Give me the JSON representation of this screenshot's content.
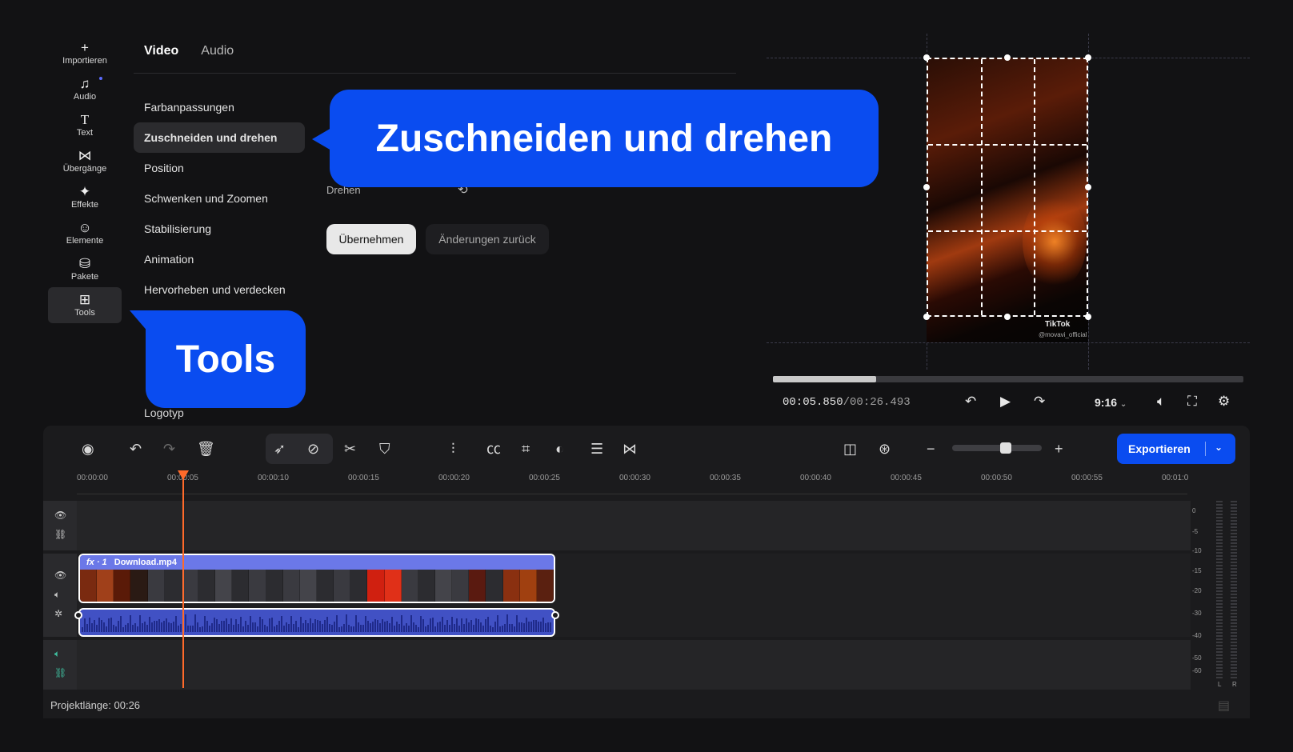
{
  "sidebar": {
    "items": [
      {
        "label": "Importieren",
        "icon": "plus-icon"
      },
      {
        "label": "Audio",
        "icon": "music-note-icon"
      },
      {
        "label": "Text",
        "icon": "text-icon"
      },
      {
        "label": "Übergänge",
        "icon": "transitions-icon"
      },
      {
        "label": "Effekte",
        "icon": "effects-icon"
      },
      {
        "label": "Elemente",
        "icon": "smiley-icon"
      },
      {
        "label": "Pakete",
        "icon": "package-icon"
      },
      {
        "label": "Tools",
        "icon": "tools-grid-icon",
        "active": true
      }
    ]
  },
  "tabs": {
    "video": "Video",
    "audio": "Audio",
    "active": "Video"
  },
  "tools_list": {
    "items": [
      "Farbanpassungen",
      "Zuschneiden und drehen",
      "Position",
      "Schwenken und Zoomen",
      "Stabilisierung",
      "Animation",
      "Hervorheben und verdecken"
    ],
    "active": "Zuschneiden und drehen",
    "partial_last": "Logotyp"
  },
  "crop_panel": {
    "rotate_label": "Drehen",
    "apply_label": "Übernehmen",
    "reset_label": "Änderungen zurück"
  },
  "callouts": {
    "crop": "Zuschneiden und drehen",
    "tools": "Tools"
  },
  "preview": {
    "watermark": "TikTok",
    "watermark_handle": "@movavi_official",
    "current_time": "00:05.850",
    "total_time": "/00:26.493",
    "progress": 0.22,
    "aspect": "9:16"
  },
  "timeline": {
    "export_label": "Exportieren",
    "ruler": [
      "00:00:00",
      "00:00:05",
      "00:00:10",
      "00:00:15",
      "00:00:20",
      "00:00:25",
      "00:00:30",
      "00:00:35",
      "00:00:40",
      "00:00:45",
      "00:00:50",
      "00:00:55",
      "00:01:0"
    ],
    "clip": {
      "fx": "fx · 1",
      "name": "Download.mp4"
    },
    "meter_labels": [
      "0",
      "-5",
      "-10",
      "-15",
      "-20",
      "-30",
      "-40",
      "-50",
      "-60"
    ],
    "meter_lr": [
      "L",
      "R"
    ],
    "project_length": "Projektlänge: 00:26",
    "zoom_level": 0.6
  },
  "colors": {
    "accent": "#0a4cf0",
    "playhead": "#ff6a2a",
    "clip": "#4a5bd8"
  }
}
